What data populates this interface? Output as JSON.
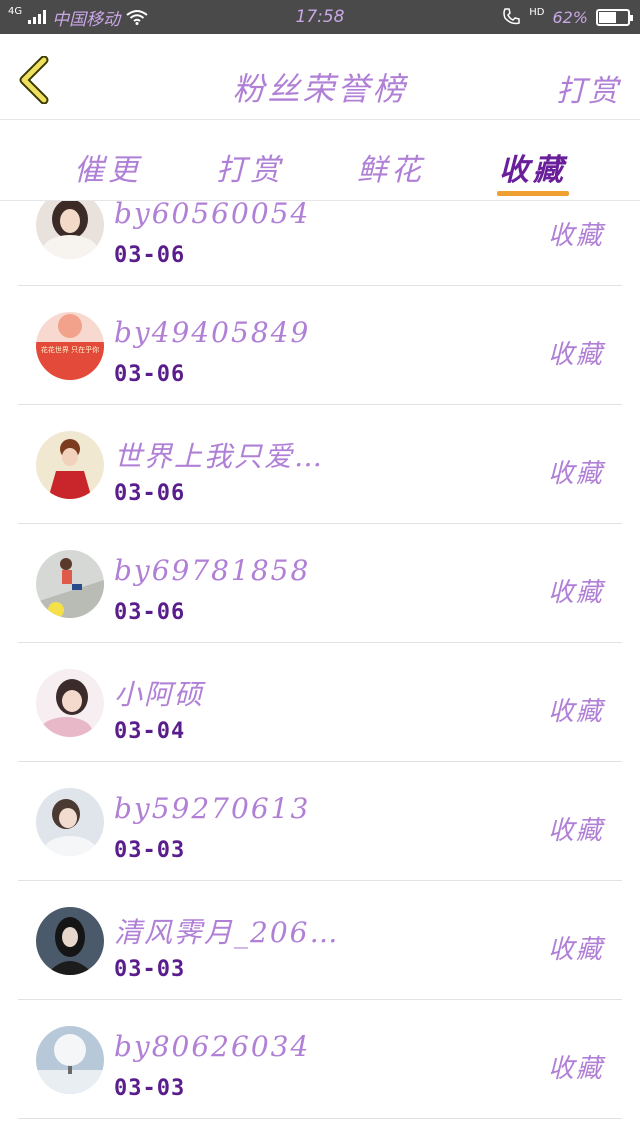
{
  "status_bar": {
    "network": "4G",
    "carrier": "中国移动",
    "time": "17:58",
    "hd": "HD",
    "battery_text": "62%",
    "battery_level": 0.62
  },
  "header": {
    "title": "粉丝荣誉榜",
    "right_button": "打赏"
  },
  "tabs": [
    {
      "label": "催更"
    },
    {
      "label": "打赏"
    },
    {
      "label": "鲜花"
    },
    {
      "label": "收藏"
    }
  ],
  "active_tab": "收藏",
  "list": [
    {
      "name": "by60560054",
      "date": "03-06",
      "action": "收藏",
      "avatar": "avatar-girl-fur"
    },
    {
      "name": "by49405849",
      "date": "03-06",
      "action": "收藏",
      "avatar": "avatar-red-banner",
      "avatar_text": "花花世界 只在乎你"
    },
    {
      "name": "世界上我只爱…",
      "date": "03-06",
      "action": "收藏",
      "avatar": "avatar-costume-red"
    },
    {
      "name": "by69781858",
      "date": "03-06",
      "action": "收藏",
      "avatar": "avatar-child-slide"
    },
    {
      "name": "小阿硕",
      "date": "03-04",
      "action": "收藏",
      "avatar": "avatar-girl-pink"
    },
    {
      "name": "by59270613",
      "date": "03-03",
      "action": "收藏",
      "avatar": "avatar-boy-white"
    },
    {
      "name": "清风霁月_206…",
      "date": "03-03",
      "action": "收藏",
      "avatar": "avatar-girl-dark"
    },
    {
      "name": "by80626034",
      "date": "03-03",
      "action": "收藏",
      "avatar": "avatar-snow-tree"
    }
  ],
  "colors": {
    "accent_purple": "#b07fd6",
    "dark_purple": "#5a1e8c",
    "tab_underline": "#f0a030",
    "status_bar_bg": "#4a4a4a"
  }
}
